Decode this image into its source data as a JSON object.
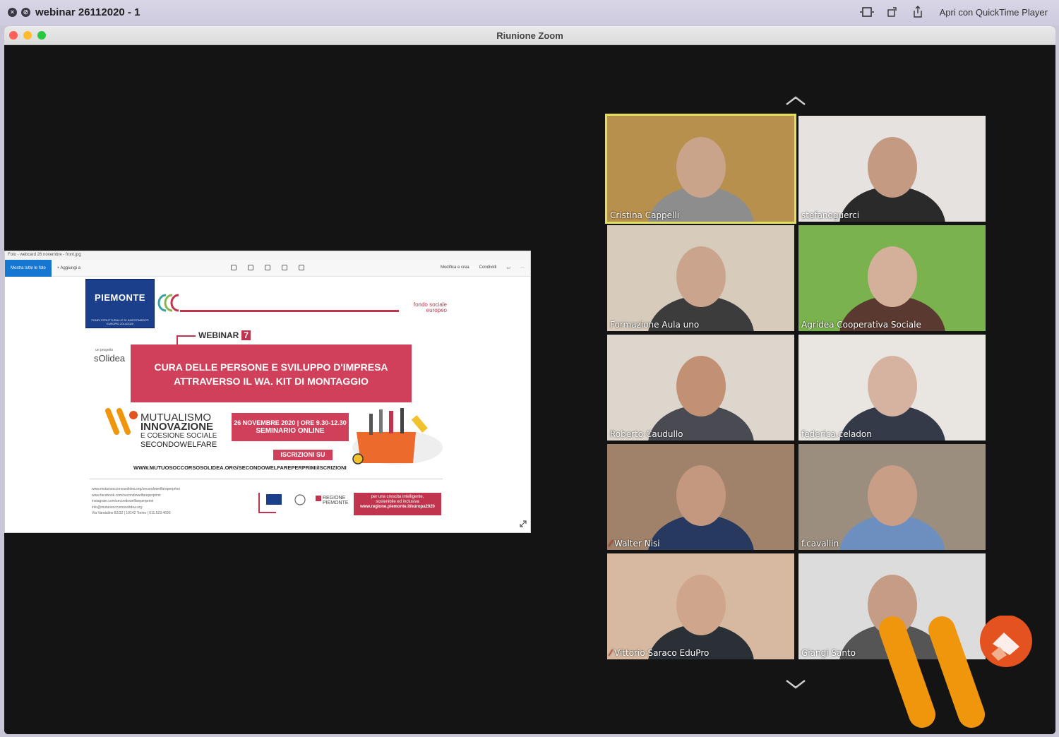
{
  "quicktime": {
    "title": "webinar 26112020 - 1",
    "open_with": "Apri con QuickTime Player",
    "close_glyph": "×",
    "stop_glyph": "⊘"
  },
  "zoom": {
    "title": "Riunione Zoom"
  },
  "shared_screen": {
    "title": "Foto - webcard 26 novembre - front.jpg",
    "show_all_button": "Mostra tutte le foto",
    "add_button": "Aggiungi a",
    "edit_button": "Modifica e crea",
    "share_button": "Condividi",
    "more": "···",
    "flyer": {
      "piemonte": "PIEMONTE",
      "piemonte_sub": "FONDI STRUTTURALI E DI INVESTIMENTO EUROPEI 2014/2020",
      "fse": "fondo sociale europeo",
      "webinar_label": "WEBINAR",
      "webinar_number": "7",
      "project_small": "un progetto",
      "solidea": "sOlidea",
      "headline_1": "CURA DELLE PERSONE E SVILUPPO D'IMPRESA",
      "headline_2": "ATTRAVERSO IL WA. KIT DI MONTAGGIO",
      "mutual_1": "MUTUALISMO",
      "mutual_2": "INNOVAZIONE",
      "mutual_3": "E COESIONE SOCIALE",
      "mutual_4": "SECONDOWELFARE",
      "date_line": "26 NOVEMBRE 2020 | ORE 9.30-12.30",
      "seminar": "SEMINARIO ONLINE",
      "iscrizioni": "ISCRIZIONI SU",
      "url": "WWW.MUTUOSOCCORSOSOLIDEA.ORG/SECONDOWELFAREPERPRIMI/ISCRIZIONI",
      "social": [
        "www.mutuosoccorsosolidea.org/secondowelfareperprimi",
        "www.facebook.com/secondowelfareperprimi",
        "instagram.com/secondowelfareperprimi",
        "info@mutuosoccorsosolidea.org",
        "Via Vandalino 82/32 | 10142 Torino | 011.523.4690"
      ],
      "regione": "REGIONE PIEMONTE",
      "region_tagline_1": "per una crescita intelligente,",
      "region_tagline_2": "sostenibile ed inclusiva",
      "region_url": "www.regione.piemonte.it/europa2020"
    }
  },
  "participants": [
    {
      "name": "Cristina Cappelli",
      "active": true,
      "muted": false,
      "bg": "#b8904e",
      "skin": "#c9a48a",
      "cloth": "#8d8d8d"
    },
    {
      "name": "stefanoguerci",
      "active": false,
      "muted": false,
      "bg": "#e6e2e0",
      "skin": "#c59a82",
      "cloth": "#2a2a2a"
    },
    {
      "name": "Formazione Aula uno",
      "active": false,
      "muted": false,
      "bg": "#d7cbbb",
      "skin": "#caa48c",
      "cloth": "#3c3c3c"
    },
    {
      "name": "Agridea Cooperativa Sociale",
      "active": false,
      "muted": false,
      "bg": "#7ab24d",
      "skin": "#d4b09b",
      "cloth": "#5a3a30"
    },
    {
      "name": "Roberto Caudullo",
      "active": false,
      "muted": false,
      "bg": "#ddd6cc",
      "skin": "#c29174",
      "cloth": "#4a4a52"
    },
    {
      "name": "federica.celadon",
      "active": false,
      "muted": false,
      "bg": "#e9e6e2",
      "skin": "#d6b3a0",
      "cloth": "#353a48"
    },
    {
      "name": "Walter Nisi",
      "active": false,
      "muted": true,
      "bg": "#a0826a",
      "skin": "#c3987e",
      "cloth": "#27395e"
    },
    {
      "name": "f.cavallin",
      "active": false,
      "muted": false,
      "bg": "#9c8e7e",
      "skin": "#c89e86",
      "cloth": "#6c8fbf"
    },
    {
      "name": "Vittorio Saraco EduPro",
      "active": false,
      "muted": true,
      "bg": "#d6b9a0",
      "skin": "#cfa68c",
      "cloth": "#2b2f36"
    },
    {
      "name": "Giangi Santo",
      "active": false,
      "muted": false,
      "bg": "#dcdcdc",
      "skin": "#c59d86",
      "cloth": "#555555"
    }
  ],
  "colors": {
    "stage": "#141414",
    "active_outline": "#e2e05b",
    "flyer_red": "#d0405a",
    "logo_orange": "#f0960c",
    "logo_circle": "#e4521f"
  }
}
